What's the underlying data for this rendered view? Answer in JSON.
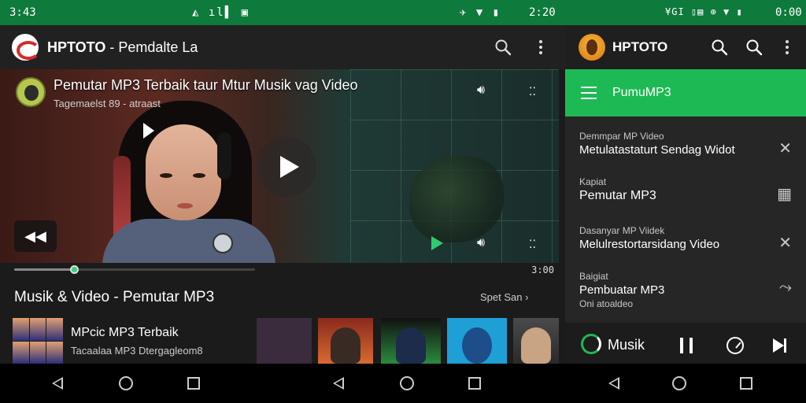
{
  "status_bar": {
    "left_time": "3:43",
    "left_icons": "◭ ıl▌ ▣",
    "middle_icons": "✈ ▼ ▮",
    "middle_time": "2:20",
    "right_icons": "¥GI ▯▤ ⊕ ▼ ▮",
    "right_time": "0:00"
  },
  "left_app": {
    "brand": "HPTOTO",
    "subtitle": " - Pemdalte La",
    "video": {
      "title": "Pemutar MP3 Terbaik taur Mtur Musik vag Video",
      "subtitle": "Tagemaelst 89 - atraast",
      "time": "3:00"
    },
    "progress": {
      "fraction": 0.25
    },
    "section": {
      "title": "Musik & Video   - Pemutar MP3",
      "right_text": "Spet   San  ›"
    },
    "featured": {
      "title": "MPcic MP3 Terbaik",
      "subtitle": "Tacaalaa MP3 Dtergagleom8"
    }
  },
  "right_app": {
    "brand": "HPTOTO",
    "green_title": "PumuMP3",
    "items": [
      {
        "label": "Demmpar MP Video",
        "text": "Metulatastaturt Sendag Widot",
        "action": "✕"
      },
      {
        "label": "Kapiat",
        "text": "Pemutar MP3",
        "action": "▦"
      },
      {
        "label": "Dasanyar MP Viidek",
        "text": "Melulrestortarsidang Video",
        "action": "✕"
      },
      {
        "label": "Baigiat",
        "text": "Pembuatar MP3",
        "extra": "Oni atoaldeo",
        "action": "⤳"
      }
    ],
    "player": {
      "label": "Musik"
    }
  },
  "colors": {
    "status_green": "#0e7a3b",
    "accent_green": "#1db954",
    "background": "#1b1b1b"
  }
}
